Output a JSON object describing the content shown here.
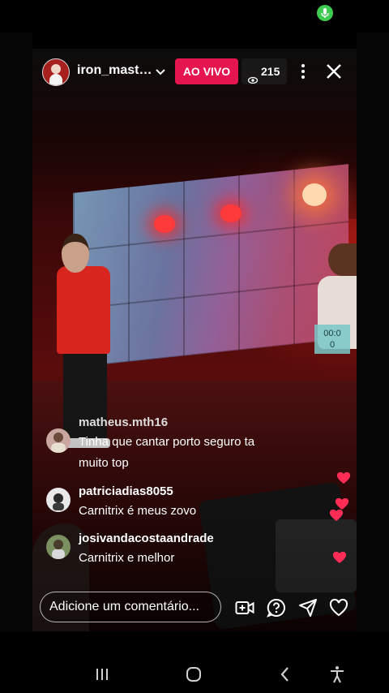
{
  "stream": {
    "username": "iron_mast…",
    "live_label": "AO VIVO",
    "viewer_count": "215",
    "timer_overlay": "00:0\n0"
  },
  "comments": [
    {
      "user": "matheus.mth16",
      "text_line1": "Tinha que cantar porto seguro ta",
      "text_line2": "muito top"
    },
    {
      "user": "patriciadias8055",
      "text_line1": "Carnitrix é meus zovo"
    },
    {
      "user": "josivandacostaandrade",
      "text_line1": "Carnitrix e melhor"
    }
  ],
  "composer": {
    "placeholder": "Adicione um comentário..."
  },
  "icons": {
    "status": "microphone-icon",
    "header": [
      "chevron-down-icon",
      "eye-icon",
      "more-options-icon",
      "close-icon"
    ],
    "actions": [
      "add-video-icon",
      "question-icon",
      "share-icon",
      "heart-icon"
    ],
    "nav": [
      "recent-apps-icon",
      "home-icon",
      "back-icon",
      "accessibility-icon"
    ]
  },
  "colors": {
    "live_badge": "#e4154f",
    "mic_indicator": "#3ecb4f",
    "heart": "#ff2d55"
  }
}
